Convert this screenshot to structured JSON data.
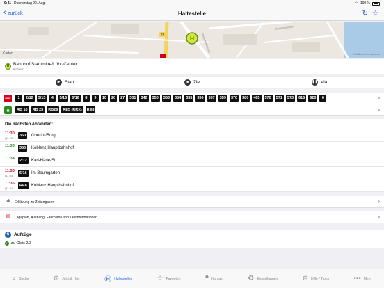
{
  "status": {
    "time": "9:41",
    "date": "Donnerstag 20. Aug.",
    "battery": "100 %"
  },
  "nav": {
    "back_label": "zurück",
    "title": "Haltestelle"
  },
  "map": {
    "label": "Karten",
    "legal": "Rechtliche Informationen",
    "street": "Moselweißer Str.",
    "street2": "Clemensstraße",
    "road_number": "49"
  },
  "station": {
    "name": "Bahnhof Stadtmitte/Löhr-Center",
    "city": "Koblenz",
    "icon": "H"
  },
  "search_options": {
    "start": "Start",
    "ziel": "Ziel",
    "via": "Via"
  },
  "bus_lines": [
    "1",
    "2/12",
    "3/13",
    "4",
    "5/15",
    "6/16",
    "8",
    "9",
    "10",
    "20",
    "27",
    "301",
    "342",
    "350",
    "353",
    "354",
    "355",
    "356",
    "357",
    "359",
    "370",
    "380",
    "485",
    "570",
    "571",
    "573",
    "615",
    "620",
    "6"
  ],
  "train_lines": [
    "RB 10",
    "RB 23",
    "RB26",
    "RE5 (RRX)",
    "RE8"
  ],
  "departures_title": "Die nächsten Abfahrten:",
  "departures": [
    {
      "time": "11:30",
      "planned": "(11:25)",
      "line": "350",
      "dest": "Obertor/Burg",
      "late": true
    },
    {
      "time": "11:33",
      "planned": "",
      "line": "350",
      "dest": "Koblenz Hauptbahnhof",
      "late": false
    },
    {
      "time": "11:34",
      "planned": "",
      "line": "2/12",
      "dest": "Karl-Härle-Str.",
      "late": false
    },
    {
      "time": "11:35",
      "planned": "(11:34)",
      "line": "6/16",
      "dest": "Im Baumgarten",
      "late": true
    },
    {
      "time": "11:35",
      "planned": "(11:34)",
      "line": "RE8",
      "dest": "Koblenz Hauptbahnhof",
      "late": true
    }
  ],
  "info": {
    "zeitangaben": "Erklärung zu Zeitangaben",
    "lageplan": "Lageplan, Aushang, Fahrpläne und Tarifinformationen"
  },
  "lifts": {
    "title": "Aufzüge",
    "status": "zu Gleis 2/3"
  },
  "tabs": [
    {
      "label": "Suche",
      "icon": "search-icon"
    },
    {
      "label": "Jetzt & Hier",
      "icon": "crosshair-icon"
    },
    {
      "label": "Haltestellen",
      "icon": "stop-icon",
      "active": true
    },
    {
      "label": "Favoriten",
      "icon": "star-icon"
    },
    {
      "label": "Kontakt",
      "icon": "chat-icon"
    },
    {
      "label": "Einstellungen",
      "icon": "gear-icon"
    },
    {
      "label": "Hilfe / Tipps",
      "icon": "lifebuoy-icon"
    },
    {
      "label": "Mehr",
      "icon": "more-icon"
    }
  ],
  "colors": {
    "accent": "#1f5fd6",
    "late": "#d0021b",
    "ontime": "#2b8a1f",
    "bus_mode": "#d0021b",
    "train_mode": "#2b8a1f"
  }
}
